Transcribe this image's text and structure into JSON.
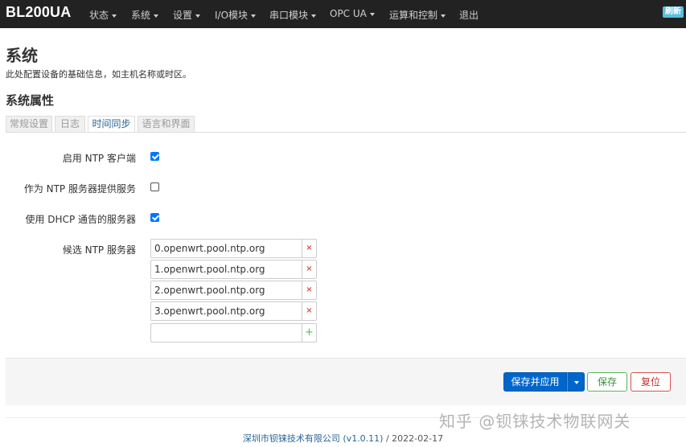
{
  "navbar": {
    "brand": "BL200UA",
    "items": [
      {
        "label": "状态",
        "dropdown": true
      },
      {
        "label": "系统",
        "dropdown": true
      },
      {
        "label": "设置",
        "dropdown": true
      },
      {
        "label": "I/O模块",
        "dropdown": true
      },
      {
        "label": "串口模块",
        "dropdown": true
      },
      {
        "label": "OPC UA",
        "dropdown": true
      },
      {
        "label": "运算和控制",
        "dropdown": true
      },
      {
        "label": "退出",
        "dropdown": false
      }
    ],
    "refresh_badge": "刷新"
  },
  "page": {
    "title": "系统",
    "description": "此处配置设备的基础信息，如主机名称或时区。",
    "section_title": "系统属性"
  },
  "tabs": [
    {
      "label": "常规设置",
      "active": false
    },
    {
      "label": "日志",
      "active": false
    },
    {
      "label": "时间同步",
      "active": true
    },
    {
      "label": "语言和界面",
      "active": false
    }
  ],
  "form": {
    "enable_ntp_client": {
      "label": "启用 NTP 客户端",
      "checked": true
    },
    "provide_ntp_server": {
      "label": "作为 NTP 服务器提供服务",
      "checked": false
    },
    "use_dhcp_servers": {
      "label": "使用 DHCP 通告的服务器",
      "checked": true
    },
    "candidate_servers": {
      "label": "候选 NTP 服务器",
      "servers": [
        "0.openwrt.pool.ntp.org",
        "1.openwrt.pool.ntp.org",
        "2.openwrt.pool.ntp.org",
        "3.openwrt.pool.ntp.org"
      ],
      "new_value": "",
      "remove_symbol": "×",
      "add_symbol": "+"
    }
  },
  "actions": {
    "save_apply": "保存并应用",
    "save": "保存",
    "reset": "复位"
  },
  "footer": {
    "company_link": "深圳市钡铼技术有限公司 (v1.0.11)",
    "separator": " / ",
    "date": "2022-02-17"
  },
  "watermark": "知乎 @钡铼技术物联网关",
  "colors": {
    "navbar_bg": "#222222",
    "primary": "#0066cc",
    "checkbox": "#0075ff",
    "remove": "#d9534f",
    "add": "#5cb85c"
  }
}
